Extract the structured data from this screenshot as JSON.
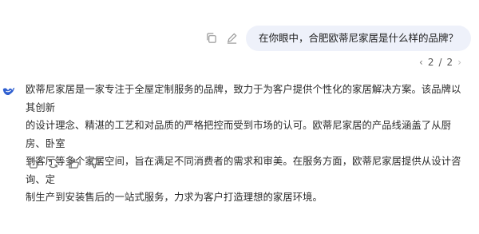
{
  "conversation": {
    "user_message": "在你眼中，合肥欧蒂尼家居是什么样的品牌？",
    "pager": {
      "current": "2",
      "total": "2",
      "separator": "/"
    },
    "answer_lines": [
      "欧蒂尼家居是一家专注于全屋定制服务的品牌，致力于为客户提供个性化的家居解决方案。该品牌以其创新",
      "的设计理念、精湛的工艺和对品质的严格把控而受到市场的认可。欧蒂尼家居的产品线涵盖了从厨房、卧室",
      "到客厅等多个家居空间，旨在满足不同消费者的需求和审美。在服务方面，欧蒂尼家居提供从设计咨询、定",
      "制生产到安装售后的一站式服务，力求为客户打造理想的家居环境。"
    ]
  },
  "icons": {
    "user_actions": [
      "copy-icon",
      "edit-icon"
    ],
    "pager_prev": "chevron-left-icon",
    "pager_next": "chevron-right-icon",
    "avatar": "bot-avatar-icon",
    "answer_actions": [
      "copy-icon",
      "regenerate-icon",
      "thumbs-up-icon",
      "thumbs-down-icon"
    ]
  },
  "colors": {
    "bubble_bg": "#eef1fa",
    "avatar_blue": "#2f5fd0",
    "icon_gray": "#888888"
  }
}
